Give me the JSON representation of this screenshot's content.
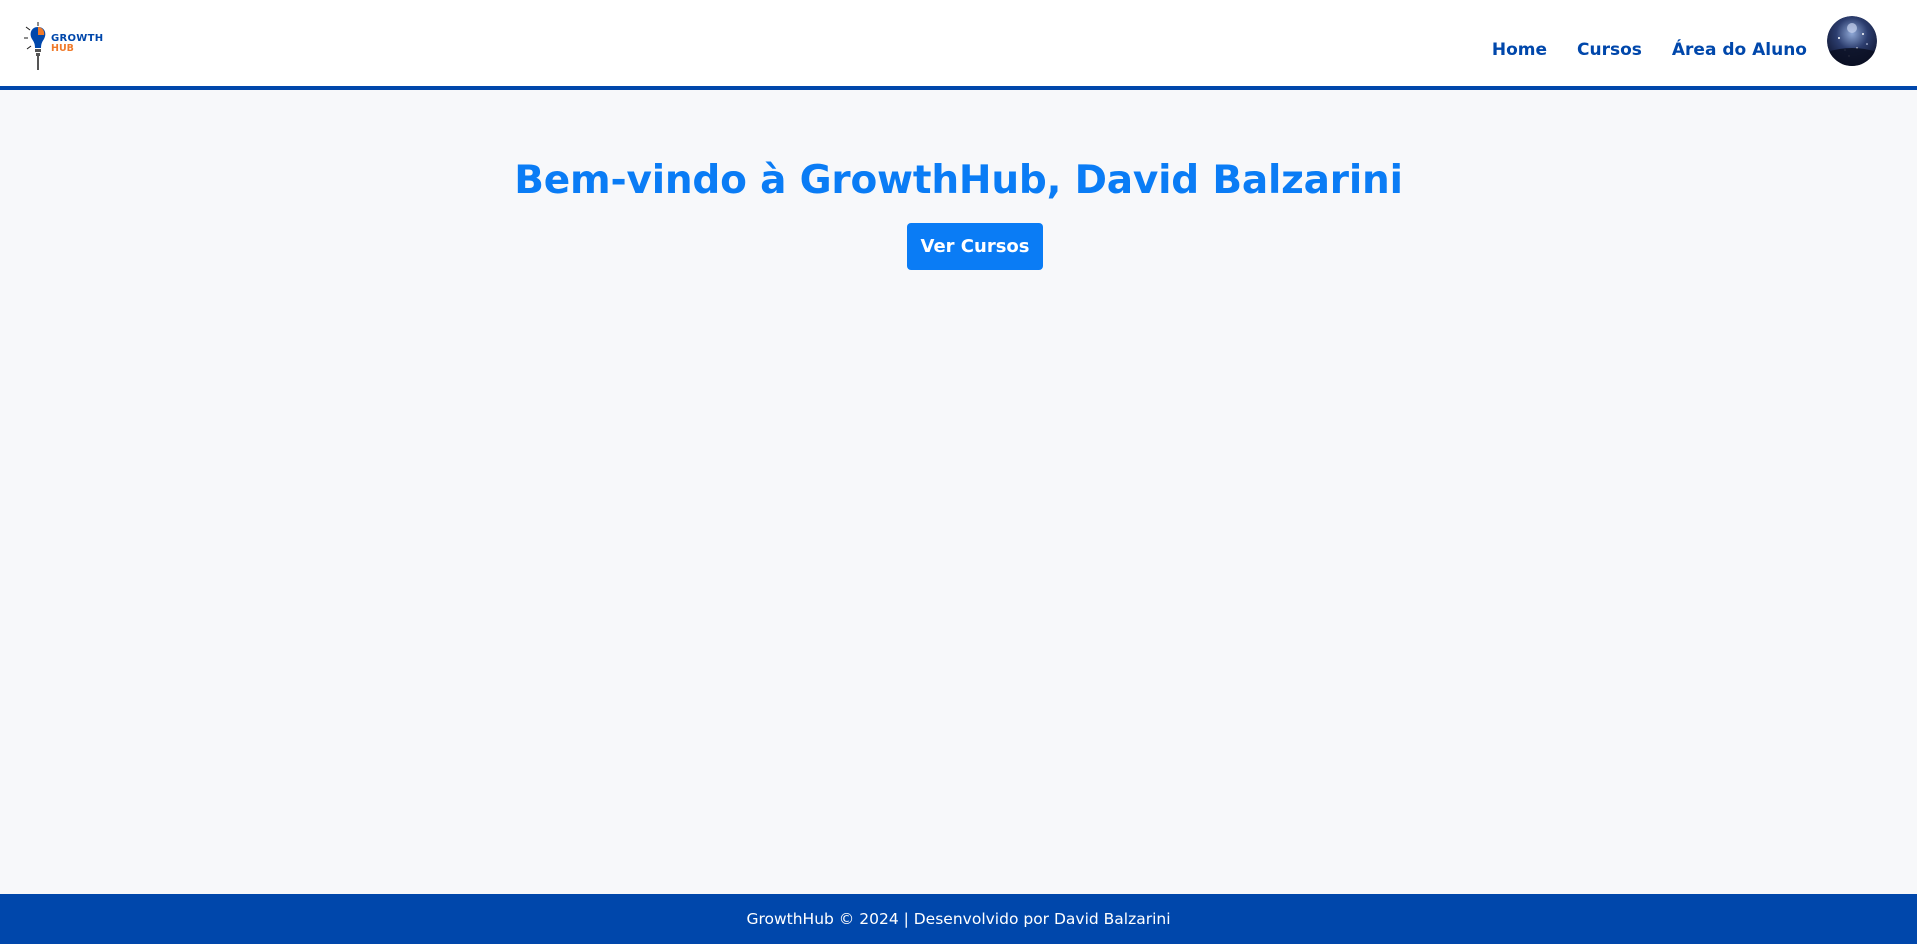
{
  "header": {
    "logo": {
      "line1": "GROWTH",
      "line2": "HUB",
      "primary_color": "#0047ab",
      "secondary_color": "#f07a2a"
    },
    "nav": [
      {
        "label": "Home"
      },
      {
        "label": "Cursos"
      },
      {
        "label": "Área do Aluno"
      }
    ],
    "border_color": "#0047ab"
  },
  "main": {
    "title": "Bem-vindo à GrowthHub, David Balzarini",
    "cta_label": "Ver Cursos",
    "accent_color": "#0a7cf5"
  },
  "footer": {
    "text": "GrowthHub © 2024 | Desenvolvido por David Balzarini",
    "background_color": "#0047ab"
  }
}
